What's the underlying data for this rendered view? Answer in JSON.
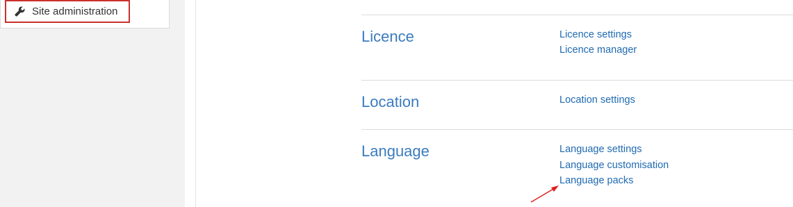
{
  "sidebar": {
    "site_admin_label": "Site administration",
    "site_admin_icon": "wrench-icon"
  },
  "sections": [
    {
      "title": "Licence",
      "links": [
        "Licence settings",
        "Licence manager"
      ]
    },
    {
      "title": "Location",
      "links": [
        "Location settings"
      ]
    },
    {
      "title": "Language",
      "links": [
        "Language settings",
        "Language customisation",
        "Language packs"
      ]
    }
  ],
  "colors": {
    "link": "#1f6ab1",
    "heading": "#3b7bbf",
    "highlight_border": "#c9302c",
    "annotation_arrow": "#e02020"
  }
}
